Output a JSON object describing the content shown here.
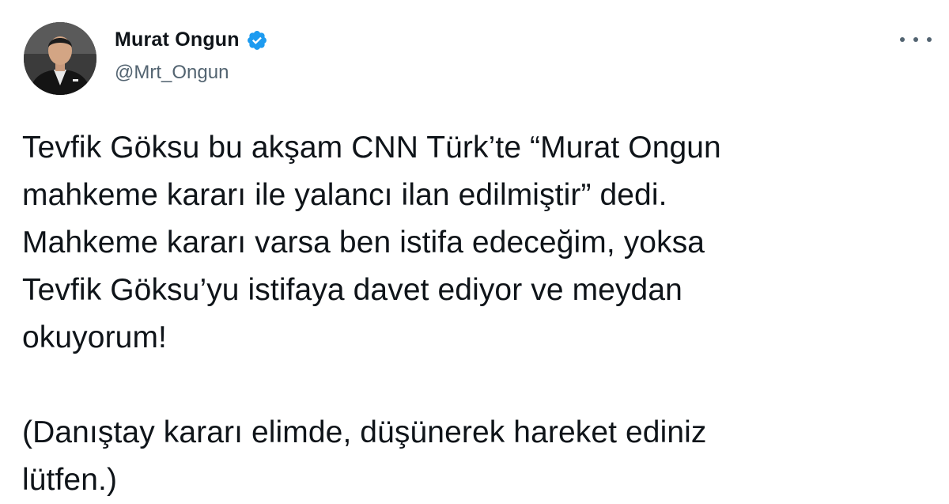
{
  "author": {
    "display_name": "Murat Ongun",
    "handle": "@Mrt_Ongun",
    "verified": true,
    "avatar_icon": "profile-photo",
    "verified_icon": "verified-badge-icon",
    "verified_color": "#1d9bf0"
  },
  "menu": {
    "icon": "more-options-icon"
  },
  "tweet": {
    "lines": [
      "Tevfik Göksu bu akşam CNN Türk’te “Murat Ongun",
      "mahkeme kararı ile yalancı ilan edilmiştir” dedi.",
      "Mahkeme kararı varsa ben istifa edeceğim, yoksa",
      "Tevfik Göksu’yu istifaya davet ediyor ve meydan",
      "okuyorum!"
    ],
    "note_lines": [
      "(Danıştay kararı elimde, düşünerek hareket ediniz",
      "lütfen.)"
    ]
  }
}
